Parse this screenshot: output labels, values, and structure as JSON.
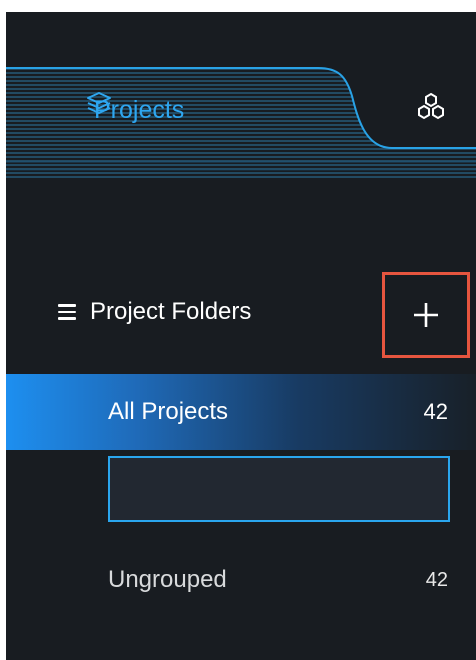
{
  "tabs": [
    {
      "label": "Projects",
      "icon": "layers-icon",
      "active": true
    },
    {
      "label": "",
      "icon": "hexagon-cluster-icon",
      "active": false
    }
  ],
  "folders": {
    "header_label": "Project Folders",
    "add_icon": "plus-icon",
    "menu_icon": "hamburger-icon"
  },
  "items": [
    {
      "label": "All Projects",
      "count": "42",
      "active": true
    },
    {
      "label": "Ungrouped",
      "count": "42",
      "active": false
    }
  ],
  "new_folder_input": {
    "value": "",
    "placeholder": ""
  },
  "colors": {
    "background": "#181c21",
    "accent": "#2ea6f0",
    "highlight_border": "#e5553f",
    "active_row_start": "#1d8ff0"
  }
}
